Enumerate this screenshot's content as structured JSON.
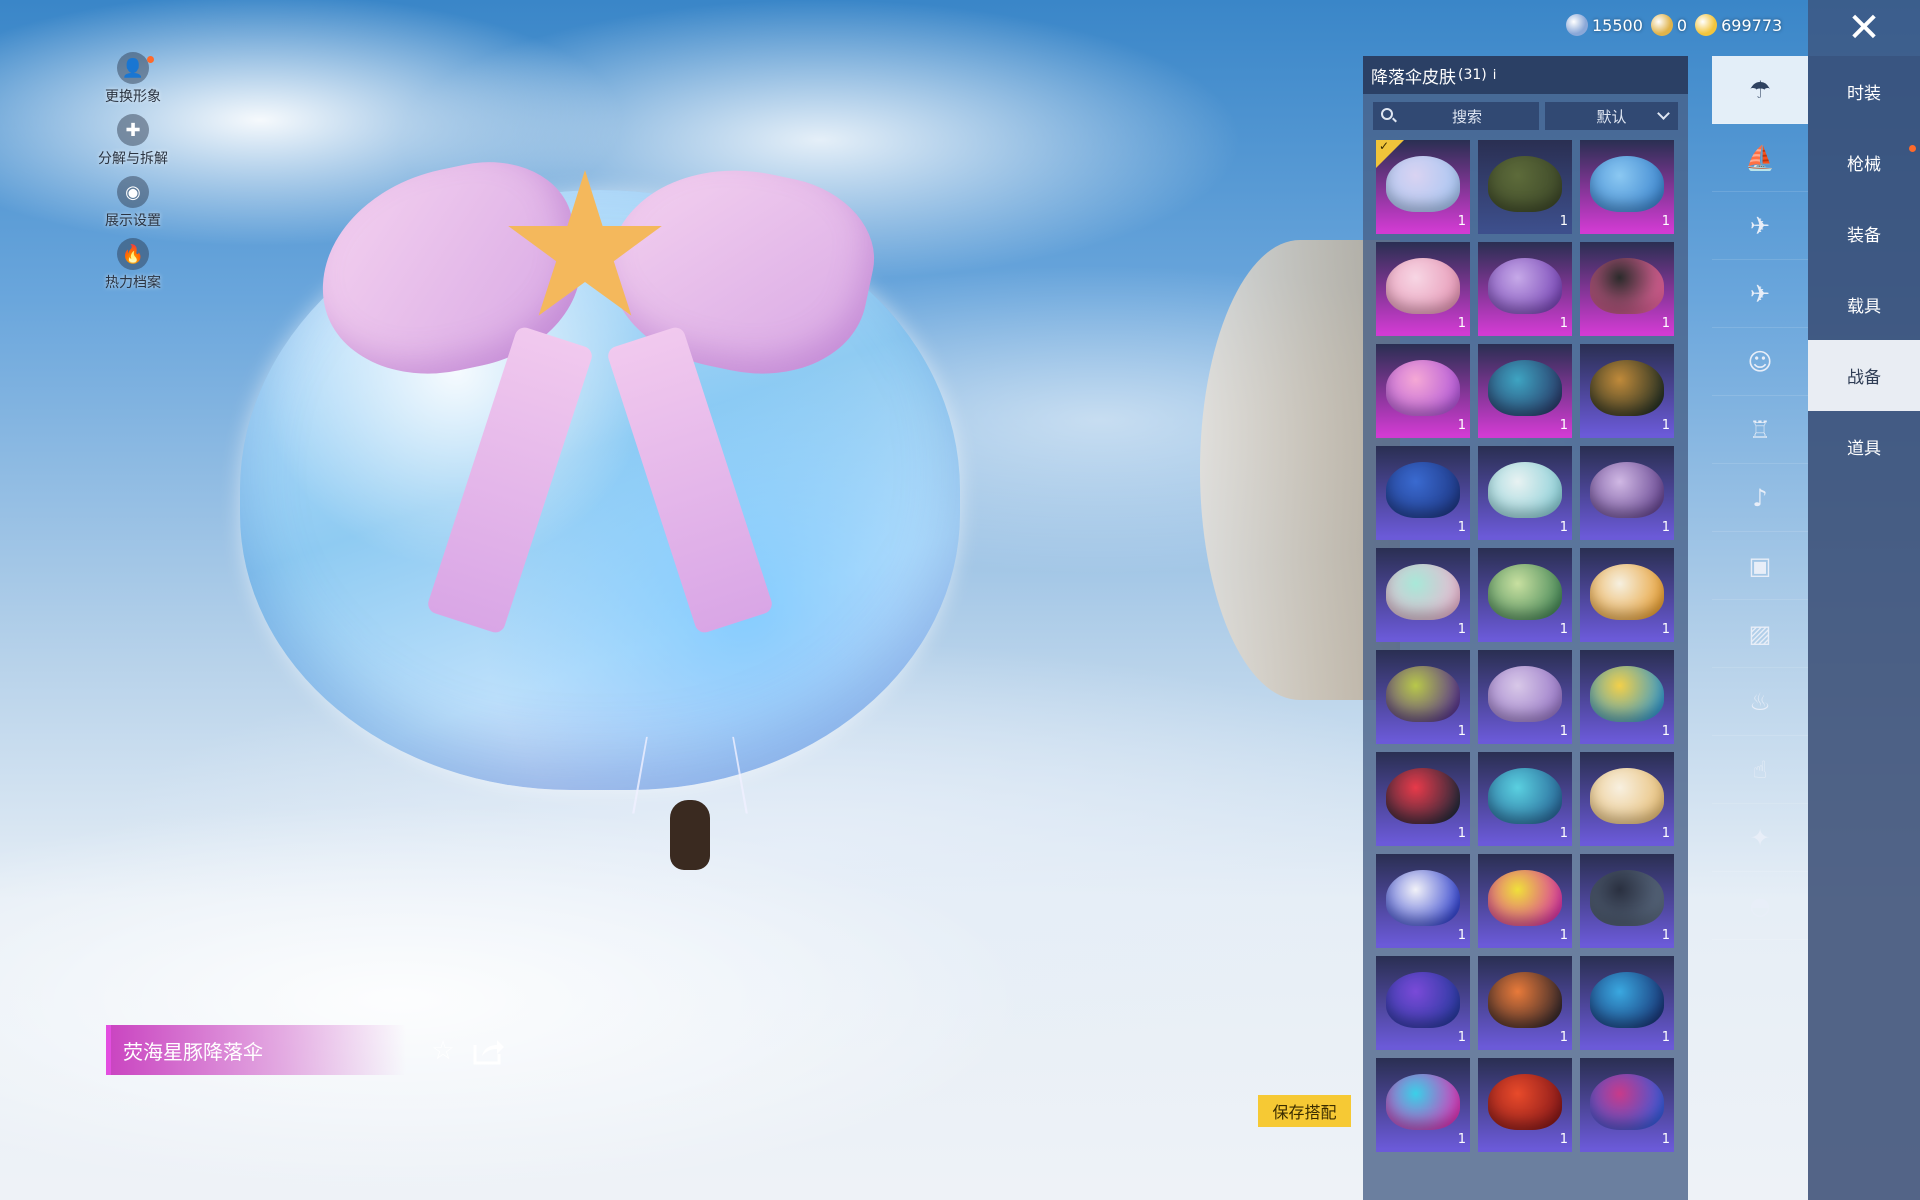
{
  "currency": [
    {
      "icon": "crystal-coin-icon",
      "value": "15500",
      "color": "#8aa8d8"
    },
    {
      "icon": "gold-medal-icon",
      "value": "0",
      "color": "#e0b34a"
    },
    {
      "icon": "lightning-coin-icon",
      "value": "699773",
      "color": "#f3c53c"
    }
  ],
  "close_label": "✕",
  "side_menu": [
    {
      "icon": "avatar-icon",
      "label": "更换形象",
      "glyph": "👤",
      "dot": true
    },
    {
      "icon": "puzzle-icon",
      "label": "分解与拆解",
      "glyph": "✚",
      "dot": false
    },
    {
      "icon": "eye-icon",
      "label": "展示设置",
      "glyph": "◉",
      "dot": false
    },
    {
      "icon": "fire-icon",
      "label": "热力档案",
      "glyph": "🔥",
      "dot": false
    }
  ],
  "item_name": "荧海星豚降落伞",
  "save_label": "保存搭配",
  "panel": {
    "title": "降落伞皮肤",
    "count": "(31)",
    "help": "ⅰ",
    "search_label": "搜索",
    "sort_label": "默认"
  },
  "items": [
    {
      "qty": "1",
      "rarity": "#d13bd2",
      "c1": "#d9d3f2",
      "c2": "#a9c6f2",
      "selected": true
    },
    {
      "qty": "1",
      "rarity": "#3d4f8c",
      "c1": "#5d6b3a",
      "c2": "#3f4a2a",
      "selected": false
    },
    {
      "qty": "1",
      "rarity": "#d13bd2",
      "c1": "#8bc8f2",
      "c2": "#3f88d0",
      "selected": false
    },
    {
      "qty": "1",
      "rarity": "#d13bd2",
      "c1": "#f7d6e4",
      "c2": "#e79ab8",
      "selected": false
    },
    {
      "qty": "1",
      "rarity": "#d13bd2",
      "c1": "#c6a9e8",
      "c2": "#7b4ab8",
      "selected": false
    },
    {
      "qty": "1",
      "rarity": "#d13bd2",
      "c1": "#2b2b2b",
      "c2": "#e4649a",
      "selected": false
    },
    {
      "qty": "1",
      "rarity": "#d13bd2",
      "c1": "#f5a8d5",
      "c2": "#b45ad8",
      "selected": false
    },
    {
      "qty": "1",
      "rarity": "#d13bd2",
      "c1": "#3ea4c2",
      "c2": "#2a3f6c",
      "selected": false
    },
    {
      "qty": "1",
      "rarity": "#6b5ad8",
      "c1": "#c08a3a",
      "c2": "#2a3324",
      "selected": false
    },
    {
      "qty": "1",
      "rarity": "#6b5ad8",
      "c1": "#3a6ad0",
      "c2": "#1f3a88",
      "selected": false
    },
    {
      "qty": "1",
      "rarity": "#6b5ad8",
      "c1": "#e8f2f2",
      "c2": "#8ed0d8",
      "selected": false
    },
    {
      "qty": "1",
      "rarity": "#6b5ad8",
      "c1": "#d0b8e4",
      "c2": "#6a4a94",
      "selected": false
    },
    {
      "qty": "1",
      "rarity": "#6b5ad8",
      "c1": "#a8e8d8",
      "c2": "#e8b8d0",
      "selected": false
    },
    {
      "qty": "1",
      "rarity": "#6b5ad8",
      "c1": "#c8e0a0",
      "c2": "#4a8a5a",
      "selected": false
    },
    {
      "qty": "1",
      "rarity": "#6b5ad8",
      "c1": "#f6f0e0",
      "c2": "#e8a23a",
      "selected": false
    },
    {
      "qty": "1",
      "rarity": "#6b5ad8",
      "c1": "#b8c84a",
      "c2": "#5a3a8a",
      "selected": false
    },
    {
      "qty": "1",
      "rarity": "#6b5ad8",
      "c1": "#d8c8e8",
      "c2": "#9a7ac8",
      "selected": false
    },
    {
      "qty": "1",
      "rarity": "#6b5ad8",
      "c1": "#f2d04a",
      "c2": "#3a9ac8",
      "selected": false
    },
    {
      "qty": "1",
      "rarity": "#6b5ad8",
      "c1": "#e83a4a",
      "c2": "#2a2a3a",
      "selected": false
    },
    {
      "qty": "1",
      "rarity": "#6b5ad8",
      "c1": "#5ad0e0",
      "c2": "#2a6a9a",
      "selected": false
    },
    {
      "qty": "1",
      "rarity": "#6b5ad8",
      "c1": "#f8f0e0",
      "c2": "#e8c07a",
      "selected": false
    },
    {
      "qty": "1",
      "rarity": "#6b5ad8",
      "c1": "#f2f2f8",
      "c2": "#3a4ad0",
      "selected": false
    },
    {
      "qty": "1",
      "rarity": "#6b5ad8",
      "c1": "#f0e03a",
      "c2": "#d83aa0",
      "selected": false
    },
    {
      "qty": "1",
      "rarity": "#6b5ad8",
      "c1": "#2a3040",
      "c2": "#5a6a80",
      "selected": false
    },
    {
      "qty": "1",
      "rarity": "#6b5ad8",
      "c1": "#7a4ad8",
      "c2": "#2a3aa0",
      "selected": false
    },
    {
      "qty": "1",
      "rarity": "#6b5ad8",
      "c1": "#e87a3a",
      "c2": "#3a2a2a",
      "selected": false
    },
    {
      "qty": "1",
      "rarity": "#6b5ad8",
      "c1": "#3aa8e0",
      "c2": "#1a3a7a",
      "selected": false
    },
    {
      "qty": "1",
      "rarity": "#6b5ad8",
      "c1": "#3ad0e8",
      "c2": "#d83ab8",
      "selected": false
    },
    {
      "qty": "1",
      "rarity": "#6b5ad8",
      "c1": "#e84a2a",
      "c2": "#8a1a1a",
      "selected": false
    },
    {
      "qty": "1",
      "rarity": "#6b5ad8",
      "c1": "#c83a8a",
      "c2": "#3a5ad8",
      "selected": false
    }
  ],
  "categories": [
    {
      "icon": "parachute-icon",
      "glyph": "☂",
      "active": true
    },
    {
      "icon": "ship-icon",
      "glyph": "⛵",
      "active": false
    },
    {
      "icon": "drone-icon",
      "glyph": "✈",
      "active": false
    },
    {
      "icon": "plane-icon",
      "glyph": "✈",
      "active": false
    },
    {
      "icon": "emote-icon",
      "glyph": "☺",
      "active": false
    },
    {
      "icon": "robot-icon",
      "glyph": "♖",
      "active": false
    },
    {
      "icon": "speaker-icon",
      "glyph": "♪",
      "active": false
    },
    {
      "icon": "card-icon",
      "glyph": "▣",
      "active": false
    },
    {
      "icon": "photo-icon",
      "glyph": "▨",
      "active": false
    },
    {
      "icon": "spray-icon",
      "glyph": "♨",
      "active": false
    },
    {
      "icon": "finger-icon",
      "glyph": "☝",
      "active": false
    },
    {
      "icon": "magic-wand-icon",
      "glyph": "✦",
      "active": false
    },
    {
      "icon": "meal-icon",
      "glyph": "◓",
      "active": false
    }
  ],
  "tabs": [
    {
      "label": "时装",
      "active": false,
      "dot": false
    },
    {
      "label": "枪械",
      "active": false,
      "dot": true
    },
    {
      "label": "装备",
      "active": false,
      "dot": false
    },
    {
      "label": "载具",
      "active": false,
      "dot": false
    },
    {
      "label": "战备",
      "active": true,
      "dot": false
    },
    {
      "label": "道具",
      "active": false,
      "dot": false
    }
  ]
}
